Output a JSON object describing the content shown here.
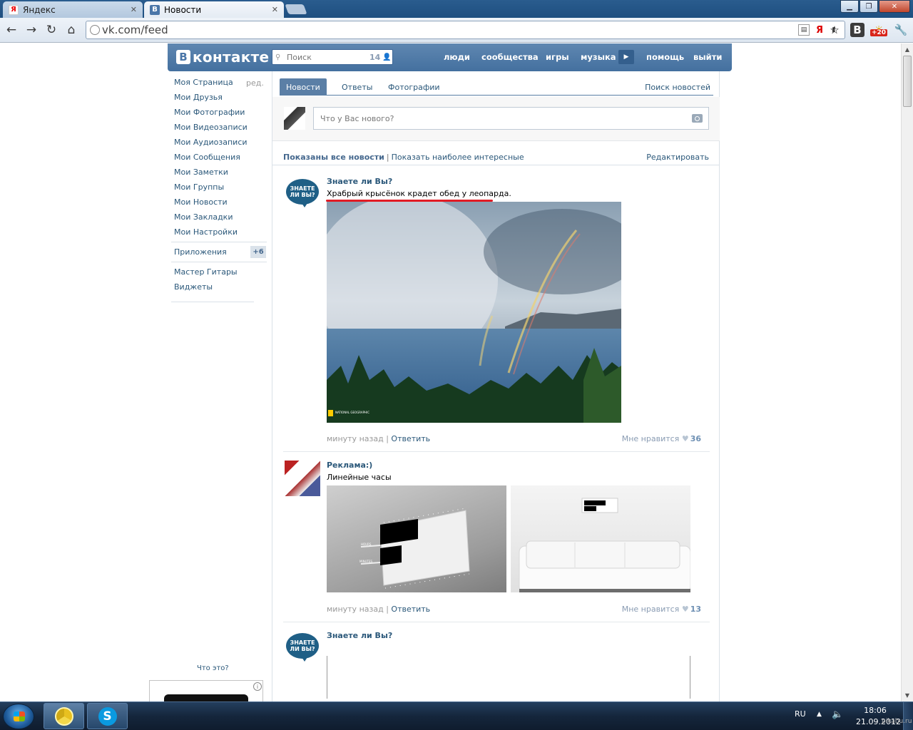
{
  "browser": {
    "tabs": [
      {
        "label": "Яндекс",
        "active": false
      },
      {
        "label": "Новости",
        "active": true
      }
    ],
    "url": "vk.com/feed",
    "extension_badge": "+20"
  },
  "vk": {
    "logo_text": "контакте",
    "logo_letter": "В",
    "search_placeholder": "Поиск",
    "search_count": "14",
    "top_menu": [
      "люди",
      "сообщества",
      "игры",
      "музыка",
      "помощь",
      "выйти"
    ],
    "left_menu": [
      "Моя Страница",
      "Мои Друзья",
      "Мои Фотографии",
      "Мои Видеозаписи",
      "Мои Аудиозаписи",
      "Мои Сообщения",
      "Мои Заметки",
      "Мои Группы",
      "Мои Новости",
      "Мои Закладки",
      "Мои Настройки"
    ],
    "edit_label": "ред.",
    "apps_label": "Приложения",
    "apps_count": "+6",
    "app_links": [
      "Мастер Гитары",
      "Виджеты"
    ],
    "ad_question": "Что это?",
    "ad_info": "i"
  },
  "feed": {
    "tabs": [
      "Новости",
      "Ответы",
      "Фотографии"
    ],
    "search_news": "Поиск новостей",
    "post_placeholder": "Что у Вас нового?",
    "filter_all": "Показаны все новости",
    "filter_interesting": "Показать наиболее интересные",
    "filter_edit": "Редактировать",
    "posts": [
      {
        "author": "Знаете ли Вы?",
        "avatar_text": "ЗНАЕТЕ ЛИ ВЫ?",
        "text": "Храбрый крысёнок крадет обед у леопарда.",
        "time": "минуту назад",
        "reply": "Ответить",
        "like_label": "Мне нравится",
        "likes": "36",
        "photo_credit": "NATIONAL GEOGRAPHIC"
      },
      {
        "author": "Реклама:)",
        "text": "Линейные часы",
        "time": "минуту назад",
        "reply": "Ответить",
        "like_label": "Мне нравится",
        "likes": "13",
        "clock_labels": [
          "HOURS",
          "MINUTES"
        ]
      },
      {
        "author": "Знаете ли Вы?",
        "avatar_text": "ЗНАЕТЕ ЛИ ВЫ?"
      }
    ]
  },
  "taskbar": {
    "lang": "RU",
    "time": "18:06",
    "date": "21.09.2012",
    "watermark": "pikabu.ru"
  },
  "colors": {
    "vk_header": "#4a76a8",
    "vk_link": "#2b587a",
    "underline_mark": "#e21b24"
  }
}
